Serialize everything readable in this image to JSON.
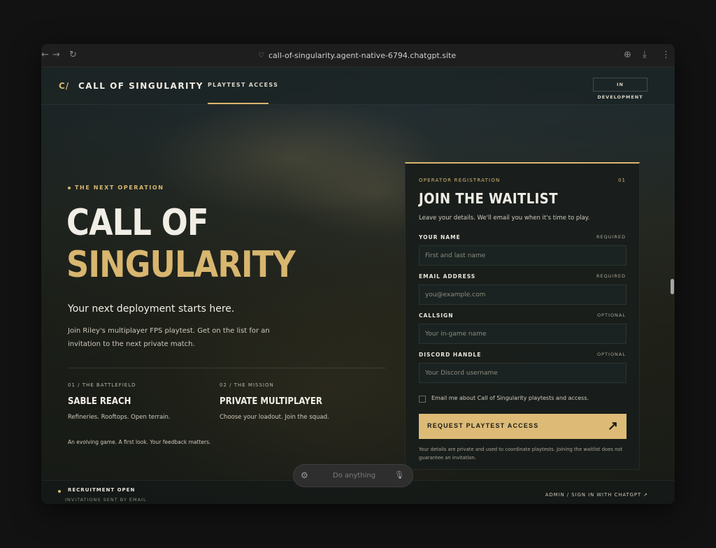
{
  "browser": {
    "url": "call-of-singularity.agent-native-6794.chatgpt.site"
  },
  "header": {
    "logo_mark": "C/",
    "brand": "CALL OF SINGULARITY",
    "nav_link": "PLAYTEST ACCESS",
    "badge": "IN DEVELOPMENT"
  },
  "hero": {
    "eyebrow": "THE NEXT OPERATION",
    "title_line1": "CALL OF",
    "title_line2": "SINGULARITY",
    "tagline": "Your next deployment starts here.",
    "description": "Join Riley's multiplayer FPS playtest. Get on the list for an invitation to the next private match.",
    "features": [
      {
        "kicker": "01 / THE BATTLEFIELD",
        "title": "SABLE REACH",
        "desc": "Refineries. Rooftops. Open terrain."
      },
      {
        "kicker": "02 / THE MISSION",
        "title": "PRIVATE MULTIPLAYER",
        "desc": "Choose your loadout. Join the squad."
      }
    ],
    "note": "An evolving game. A first look. Your feedback matters."
  },
  "form": {
    "kicker": "OPERATOR REGISTRATION",
    "number": "01",
    "title": "JOIN THE WAITLIST",
    "subtitle": "Leave your details. We'll email you when it's time to play.",
    "fields": [
      {
        "label": "YOUR NAME",
        "req": "REQUIRED",
        "placeholder": "First and last name"
      },
      {
        "label": "EMAIL ADDRESS",
        "req": "REQUIRED",
        "placeholder": "you@example.com"
      },
      {
        "label": "CALLSIGN",
        "req": "OPTIONAL",
        "placeholder": "Your in-game name"
      },
      {
        "label": "DISCORD HANDLE",
        "req": "OPTIONAL",
        "placeholder": "Your Discord username"
      }
    ],
    "checkbox_label": "Email me about Call of Singularity playtests and access.",
    "submit_label": "REQUEST PLAYTEST ACCESS",
    "fine_print": "Your details are private and used to coordinate playtests. Joining the waitlist does not guarantee an invitation."
  },
  "footer": {
    "status": "RECRUITMENT OPEN",
    "status_sub": "INVITATIONS SENT BY EMAIL",
    "admin_link": "ADMIN / SIGN IN WITH CHATGPT ↗"
  },
  "command_bar": {
    "placeholder": "Do anything"
  },
  "colors": {
    "accent": "#d8b66f",
    "background": "#1f2624",
    "text": "#f1eee6"
  }
}
